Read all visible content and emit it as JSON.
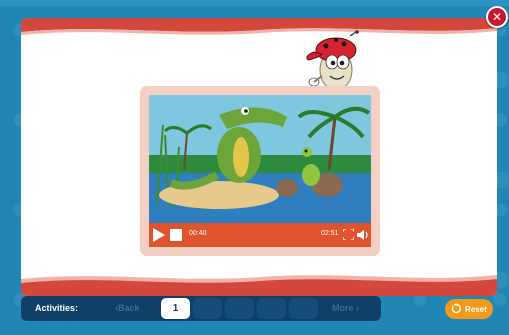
{
  "window": {
    "close_icon": "close-x-icon",
    "close_glyph": "✕"
  },
  "video": {
    "current_time": "00:40",
    "total_time": "02:51",
    "play_icon": "play-icon",
    "stop_icon": "stop-icon",
    "fullscreen_icon": "fullscreen-icon",
    "volume_icon": "volume-icon",
    "accent_color": "#e0542d",
    "frame_color": "#f4cfc4"
  },
  "nav": {
    "activities_label": "Activities:",
    "back_label": "‹Back",
    "more_label": "More ›",
    "current_page": "1",
    "bar_color": "#0f3f66"
  },
  "reset": {
    "label": "Reset",
    "icon": "reset-icon",
    "color": "#f39a18"
  },
  "theme": {
    "background": "#1f86b6",
    "banner_red": "#d4473c"
  }
}
